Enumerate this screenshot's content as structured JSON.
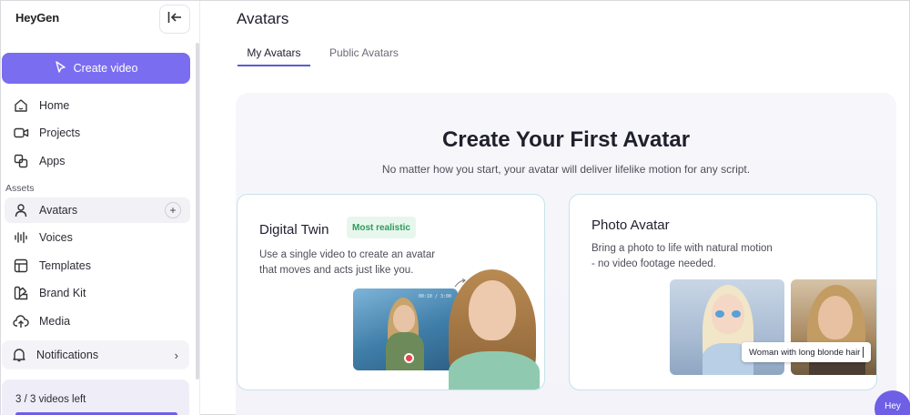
{
  "sidebar": {
    "logo": "HeyGen",
    "create_label": "Create video",
    "nav": [
      {
        "label": "Home",
        "icon": "home-icon"
      },
      {
        "label": "Projects",
        "icon": "video-camera-icon"
      },
      {
        "label": "Apps",
        "icon": "apps-icon"
      }
    ],
    "section_label": "Assets",
    "assets": [
      {
        "label": "Avatars",
        "icon": "avatar-icon",
        "active": true
      },
      {
        "label": "Voices",
        "icon": "voice-wave-icon"
      },
      {
        "label": "Templates",
        "icon": "templates-icon"
      },
      {
        "label": "Brand Kit",
        "icon": "brand-kit-icon"
      },
      {
        "label": "Media",
        "icon": "cloud-upload-icon"
      }
    ],
    "notifications_label": "Notifications",
    "quota_text": "3 / 3 videos left"
  },
  "main": {
    "title": "Avatars",
    "tabs": [
      {
        "label": "My Avatars",
        "active": true
      },
      {
        "label": "Public Avatars",
        "active": false
      }
    ],
    "hero": {
      "title": "Create Your First Avatar",
      "subtitle": "No matter how you start, your avatar will deliver lifelike motion for any script."
    },
    "cards": [
      {
        "title": "Digital Twin",
        "badge": "Most realistic",
        "description_line1": "Use a single video to create an avatar",
        "description_line2": "that moves and acts just like you.",
        "video_time": "00:10 / 3:00"
      },
      {
        "title": "Photo Avatar",
        "description_line1": "Bring a photo to life with natural motion",
        "description_line2": "- no video footage needed.",
        "caption": "Woman with long blonde hair"
      }
    ]
  },
  "chat": {
    "label": "Hey"
  },
  "colors": {
    "accent": "#7b6df0",
    "badge_bg": "#e8f7ee",
    "badge_text": "#2f9a5a",
    "record": "#e84545"
  }
}
